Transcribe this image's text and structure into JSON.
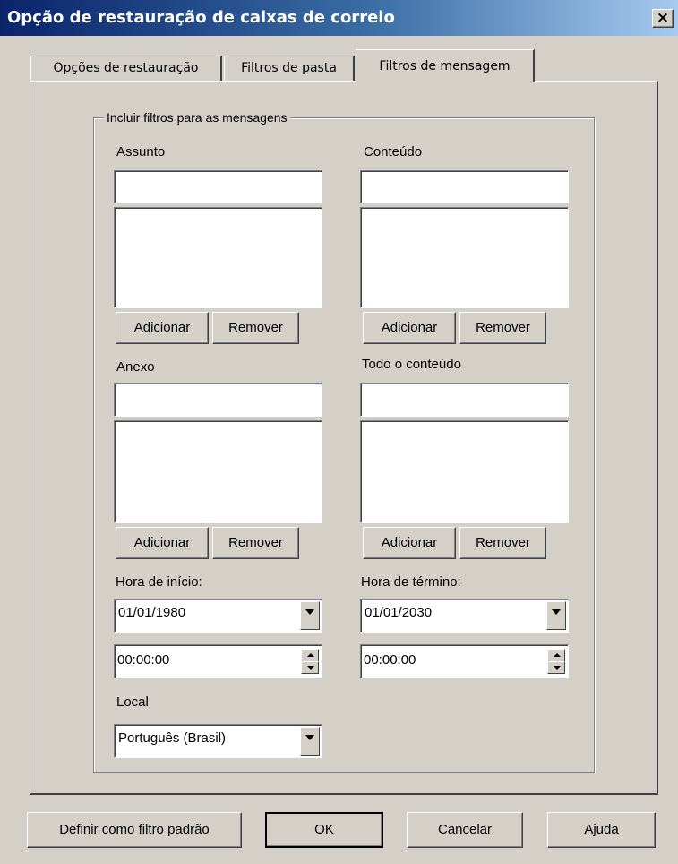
{
  "window": {
    "title": "Opção de restauração de caixas de correio",
    "close_label": "×"
  },
  "tabs": [
    {
      "label": "Opções de restauração"
    },
    {
      "label": "Filtros de pasta"
    },
    {
      "label": "Filtros de mensagem"
    }
  ],
  "group": {
    "legend": "Incluir filtros para as mensagens"
  },
  "filters": {
    "subject": {
      "label": "Assunto",
      "value": "",
      "add": "Adicionar",
      "remove": "Remover"
    },
    "content": {
      "label": "Conteúdo",
      "value": "",
      "add": "Adicionar",
      "remove": "Remover"
    },
    "attachment": {
      "label": "Anexo",
      "value": "",
      "add": "Adicionar",
      "remove": "Remover"
    },
    "all_content": {
      "label": "Todo o conteúdo",
      "value": "",
      "add": "Adicionar",
      "remove": "Remover"
    }
  },
  "start": {
    "label": "Hora de início:",
    "date": "01/01/1980",
    "time": "00:00:00"
  },
  "end": {
    "label": "Hora de término:",
    "date": "01/01/2030",
    "time": "00:00:00"
  },
  "locale": {
    "label": "Local",
    "value": "Português (Brasil)"
  },
  "footer": {
    "default_filter": "Definir como filtro padrão",
    "ok": "OK",
    "cancel": "Cancelar",
    "help": "Ajuda"
  }
}
